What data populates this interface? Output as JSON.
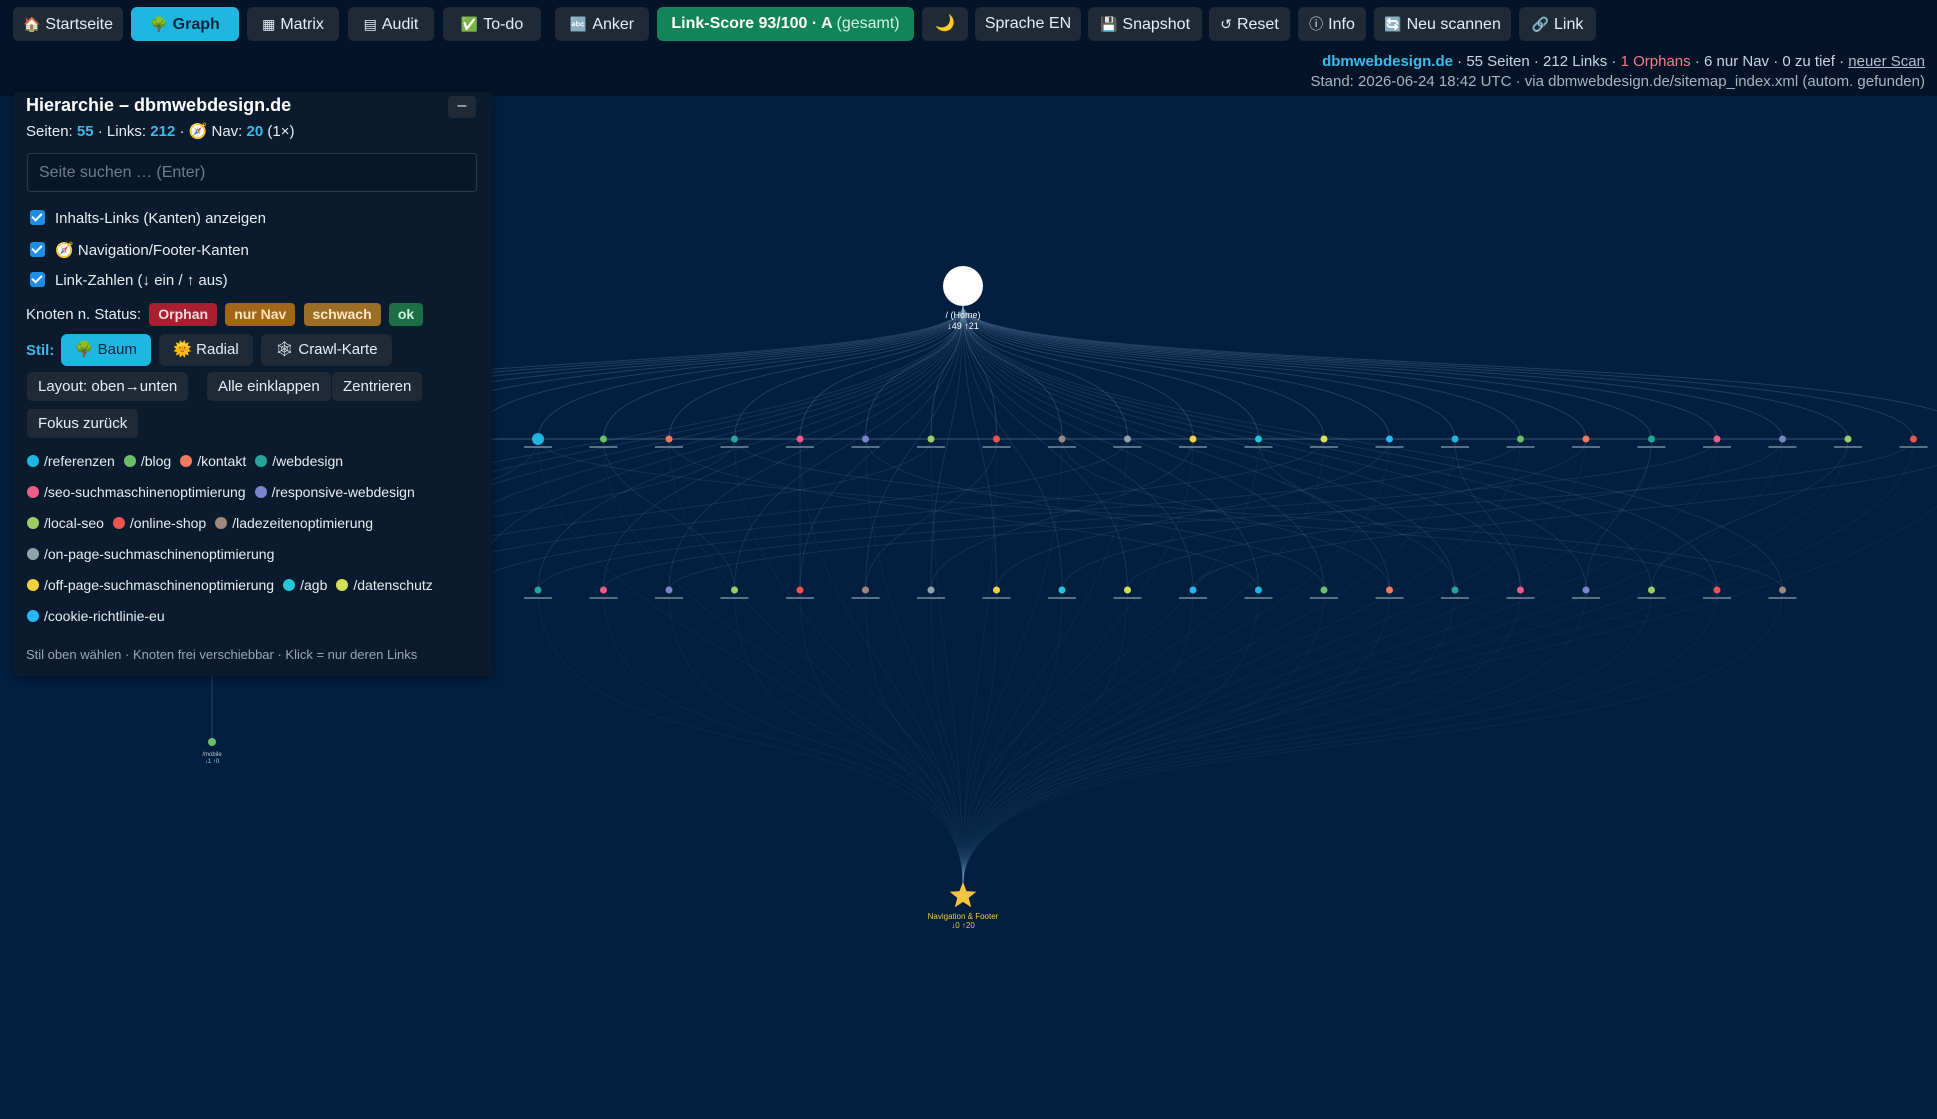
{
  "colors": {
    "background": "#031f3f",
    "accent": "#1fb6e0",
    "score_green": "#12845a",
    "badge_orphan": "#a82030",
    "badge_nav": "#a2661a",
    "badge_weak": "#9c6d25",
    "badge_ok": "#1e6e45"
  },
  "toolbar": {
    "home_icon": "home-icon",
    "home_label": "Startseite",
    "graph_icon": "tree-icon",
    "graph_label": "Graph",
    "matrix_label": "Matrix",
    "audit_label": "Audit",
    "todo_label": "To-do",
    "anker_label": "Anker",
    "score_label": "Link-Score 93/100 · A",
    "score_suffix": "(gesamt)",
    "theme_icon": "moon-icon",
    "lang_label": "Sprache EN",
    "snapshot_label": "Snapshot",
    "reset_label": "Reset",
    "info_label": "Info",
    "rescan_label": "Neu scannen",
    "link_label": "Link"
  },
  "status": {
    "domain": "dbmwebdesign.de",
    "pages": "55 Seiten",
    "links": "212 Links",
    "orphans": "1 Orphans",
    "nav_only": "6 nur Nav",
    "too_deep": "0 zu tief",
    "new_scan": "neuer Scan",
    "line2": "Stand: 2026-06-24 18:42 UTC · via dbmwebdesign.de/sitemap_index.xml (autom. gefunden)"
  },
  "panel": {
    "title": "Hierarchie – dbmwebdesign.de",
    "collapse_label": "–",
    "stats_pages_label": "Seiten:",
    "stats_pages": "55",
    "stats_links_label": "Links:",
    "stats_links": "212",
    "stats_nav_label": "Nav:",
    "stats_nav": "20",
    "stats_nav_suffix": "(1×)",
    "search_placeholder": "Seite suchen … (Enter)",
    "checkbox_edges": "Inhalts-Links (Kanten) anzeigen",
    "checkbox_nav": "Navigation/Footer-Kanten",
    "checkbox_counts": "Link-Zahlen (↓ ein / ↑ aus)",
    "status_label": "Knoten n. Status:",
    "badges": [
      "Orphan",
      "nur Nav",
      "schwach",
      "ok"
    ],
    "style_label": "Stil:",
    "style_tree": "Baum",
    "style_radial": "Radial",
    "style_crawl": "Crawl-Karte",
    "layout_btn": "Layout: oben→unten",
    "collapse_all_btn": "Alle einklappen",
    "center_btn": "Zentrieren",
    "focus_back_btn": "Fokus zurück",
    "legend": [
      {
        "label": "/referenzen",
        "color": "#1fb6e0"
      },
      {
        "label": "/blog",
        "color": "#6abf69"
      },
      {
        "label": "/kontakt",
        "color": "#f07b5e"
      },
      {
        "label": "/webdesign",
        "color": "#26a69a"
      },
      {
        "label": "/seo-suchmaschinenoptimierung",
        "color": "#ec5d8a"
      },
      {
        "label": "/responsive-webdesign",
        "color": "#7986cb"
      },
      {
        "label": "/local-seo",
        "color": "#9ccc65"
      },
      {
        "label": "/online-shop",
        "color": "#ef5350"
      },
      {
        "label": "/ladezeitenoptimierung",
        "color": "#a1887f"
      },
      {
        "label": "/on-page-suchmaschinenoptimierung",
        "color": "#90a4ae"
      },
      {
        "label": "/off-page-suchmaschinenoptimierung",
        "color": "#f4d03f"
      },
      {
        "label": "/agb",
        "color": "#26c6da"
      },
      {
        "label": "/datenschutz",
        "color": "#d4e157"
      },
      {
        "label": "/cookie-richtlinie-eu",
        "color": "#29b6f6"
      }
    ],
    "hint": "Stil oben wählen · Knoten frei verschiebbar · Klick = nur deren Links"
  },
  "graph": {
    "root_label": "/ (Home)",
    "root_counts": "↓49 ↑21",
    "nav_label": "Navigation & Footer",
    "nav_counts": "↓0 ↑20",
    "orphan_label": "/mobile",
    "orphan_counts": "↓1 ↑0"
  }
}
